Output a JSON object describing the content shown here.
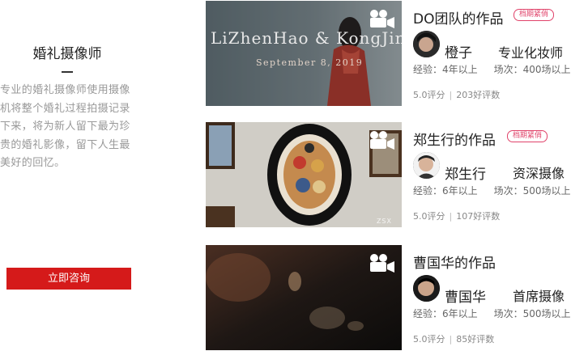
{
  "sidebar": {
    "title": "婚礼摄像师",
    "description": "专业的婚礼摄像师使用摄像机将整个婚礼过程拍摄记录下来，将为新人留下最为珍贵的婚礼影像，留下人生最美好的回忆。",
    "consult_label": "立即咨询"
  },
  "cards": [
    {
      "title": "DO团队的作品",
      "badge": "档期紧俏",
      "name": "橙子",
      "role": "专业化妆师",
      "experience": "经验：4年以上",
      "sessions": "场次：400场以上",
      "score": "5.0评分",
      "reviews": "203好评数",
      "thumb_caption": "LiZhenHao & KongJing",
      "thumb_date": "September 8, 2019"
    },
    {
      "title": "郑生行的作品",
      "badge": "档期紧俏",
      "name": "郑生行",
      "role": "资深摄像",
      "experience": "经验：6年以上",
      "sessions": "场次：500场以上",
      "score": "5.0评分",
      "reviews": "107好评数",
      "watermark": "ZSX"
    },
    {
      "title": "曹国华的作品",
      "name": "曹国华",
      "role": "首席摄像",
      "experience": "经验：6年以上",
      "sessions": "场次：500场以上",
      "score": "5.0评分",
      "reviews": "85好评数"
    }
  ],
  "icons": {
    "video": "video-camera-icon"
  },
  "colors": {
    "accent": "#d51a1a",
    "badge": "#e0436a"
  }
}
